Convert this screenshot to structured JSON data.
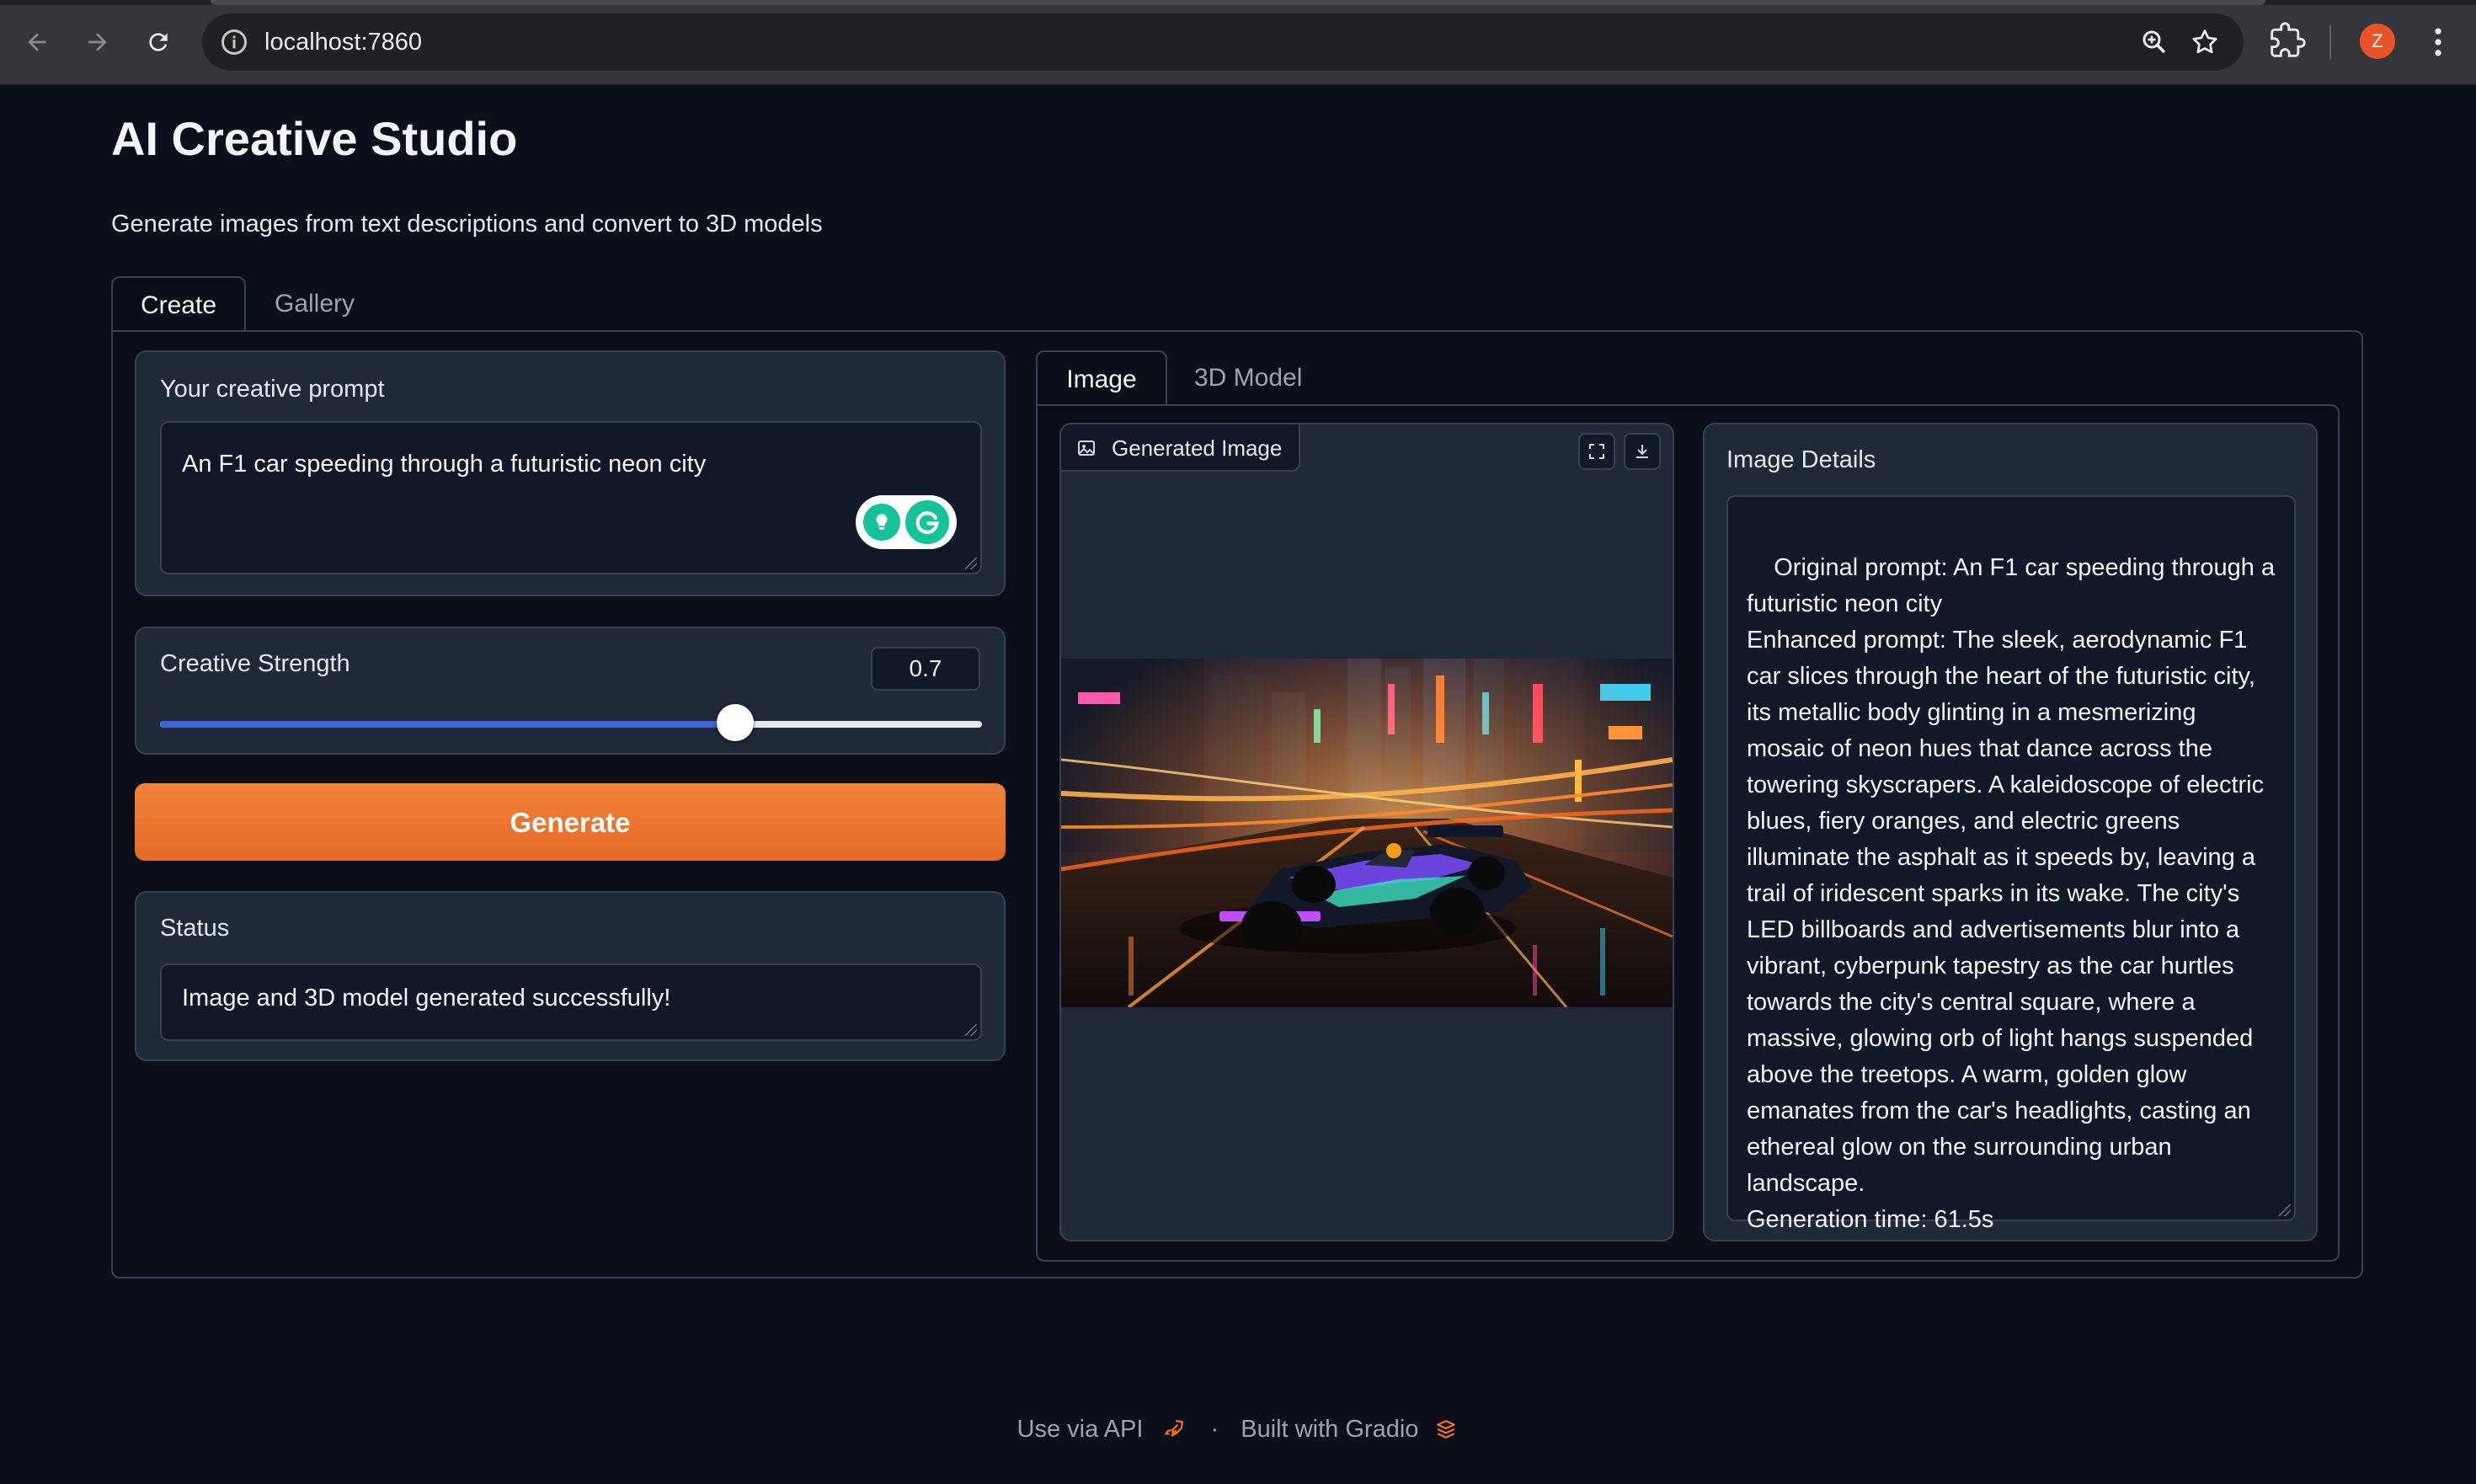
{
  "browser": {
    "url": "localhost:7860",
    "profile_initial": "Z"
  },
  "app": {
    "title": "AI Creative Studio",
    "subtitle": "Generate images from text descriptions and convert to 3D models",
    "tabs": [
      {
        "label": "Create",
        "active": true
      },
      {
        "label": "Gallery",
        "active": false
      }
    ]
  },
  "prompt": {
    "label": "Your creative prompt",
    "value": "An F1 car speeding through a futuristic neon city"
  },
  "strength": {
    "label": "Creative Strength",
    "value": "0.7",
    "fraction": 0.7
  },
  "generate_label": "Generate",
  "status": {
    "label": "Status",
    "value": "Image and 3D model generated successfully!"
  },
  "output": {
    "tabs": [
      {
        "label": "Image",
        "active": true
      },
      {
        "label": "3D Model",
        "active": false
      }
    ],
    "image_label": "Generated Image"
  },
  "details": {
    "label": "Image Details",
    "text": "Original prompt: An F1 car speeding through a futuristic neon city\nEnhanced prompt: The sleek, aerodynamic F1 car slices through the heart of the futuristic city, its metallic body glinting in a mesmerizing mosaic of neon hues that dance across the towering skyscrapers. A kaleidoscope of electric blues, fiery oranges, and electric greens illuminate the asphalt as it speeds by, leaving a trail of iridescent sparks in its wake. The city's LED billboards and advertisements blur into a vibrant, cyberpunk tapestry as the car hurtles towards the city's central square, where a massive, glowing orb of light hangs suspended above the treetops. A warm, golden glow emanates from the car's headlights, casting an ethereal glow on the surrounding urban landscape.\nGeneration time: 61.5s"
  },
  "footer": {
    "api": "Use via API",
    "separator": "·",
    "built": "Built with Gradio"
  },
  "colors": {
    "background": "#0b0f19",
    "block": "#1f2937",
    "accent_orange": "#e8752e",
    "slider_blue": "#3b66dc"
  }
}
